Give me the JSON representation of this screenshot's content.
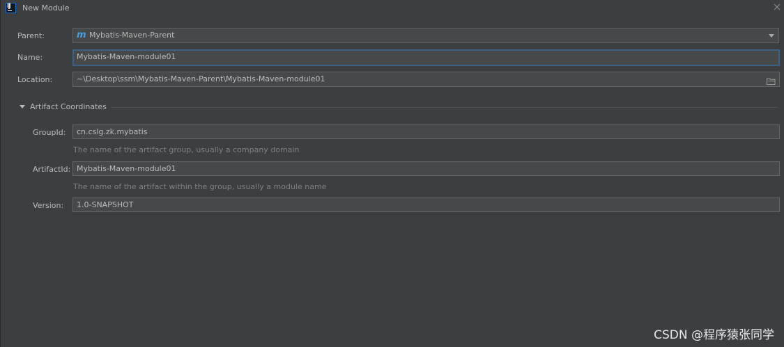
{
  "window": {
    "title": "New Module",
    "app_icon": "intellij-icon",
    "close_icon": "close-icon"
  },
  "form": {
    "parent": {
      "label": "Parent:",
      "value": "Mybatis-Maven-Parent",
      "icon": "maven-icon",
      "icon_glyph": "m"
    },
    "name": {
      "label": "Name:",
      "value": "Mybatis-Maven-module01"
    },
    "location": {
      "label": "Location:",
      "value": "~\\Desktop\\ssm\\Mybatis-Maven-Parent\\Mybatis-Maven-module01",
      "icon": "folder-icon"
    }
  },
  "artifact": {
    "section_title": "Artifact Coordinates",
    "expanded": true,
    "group_id": {
      "label": "GroupId:",
      "value": "cn.cslg.zk.mybatis",
      "hint": "The name of the artifact group, usually a company domain"
    },
    "artifact_id": {
      "label": "ArtifactId:",
      "value": "Mybatis-Maven-module01",
      "hint": "The name of the artifact within the group, usually a module name"
    },
    "version": {
      "label": "Version:",
      "value": "1.0-SNAPSHOT"
    }
  },
  "watermark": "CSDN @程序猿张同学",
  "colors": {
    "background": "#3c3f41",
    "field_background": "#45494a",
    "focus_border": "#3d6185",
    "text": "#bbbbbb",
    "hint_text": "#808080",
    "maven_icon": "#4a9fe0"
  }
}
